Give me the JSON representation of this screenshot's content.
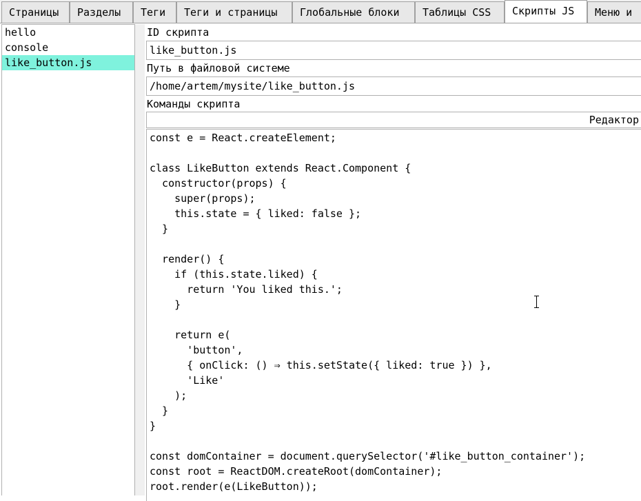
{
  "tabs": [
    {
      "label": "Страницы",
      "active": false
    },
    {
      "label": "Разделы",
      "active": false
    },
    {
      "label": "Теги",
      "active": false
    },
    {
      "label": "Теги и страницы",
      "active": false
    },
    {
      "label": "Глобальные блоки",
      "active": false
    },
    {
      "label": "Таблицы CSS",
      "active": false
    },
    {
      "label": "Скрипты JS",
      "active": true
    },
    {
      "label": "Меню и",
      "active": false
    }
  ],
  "script_list": {
    "items": [
      "hello",
      "console",
      "like_button.js"
    ],
    "selected": "like_button.js"
  },
  "form": {
    "id_label": "ID скрипта",
    "id_value": "like_button.js",
    "path_label": "Путь в файловой системе",
    "path_value": "/home/artem/mysite/like_button.js",
    "commands_label": "Команды скрипта",
    "editor_label": "Редактор"
  },
  "code_lines": [
    "const e = React.createElement;",
    "",
    "class LikeButton extends React.Component {",
    "  constructor(props) {",
    "    super(props);",
    "    this.state = { liked: false };",
    "  }",
    "",
    "  render() {",
    "    if (this.state.liked) {",
    "      return 'You liked this.';",
    "    }",
    "",
    "    return e(",
    "      'button',",
    "      { onClick: () ⇒ this.setState({ liked: true }) },",
    "      'Like'",
    "    );",
    "  }",
    "}",
    "",
    "const domContainer = document.querySelector('#like_button_container');",
    "const root = ReactDOM.createRoot(domContainer);",
    "root.render(e(LikeButton));"
  ]
}
